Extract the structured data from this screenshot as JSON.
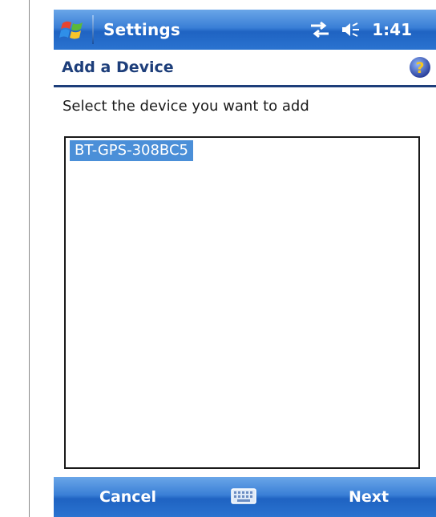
{
  "titlebar": {
    "app_title": "Settings",
    "time": "1:41",
    "icons": [
      "windows-start-icon",
      "connectivity-icon",
      "speaker-icon"
    ]
  },
  "header": {
    "page_title": "Add a Device",
    "help_icon": "help-icon"
  },
  "main": {
    "instruction": "Select the device you want to add",
    "devices": [
      {
        "name": "BT-GPS-308BC5",
        "selected": true
      }
    ]
  },
  "menubar": {
    "left_softkey": "Cancel",
    "right_softkey": "Next",
    "center_icon": "keyboard-icon"
  },
  "colors": {
    "bar_blue": "#2a73d0",
    "title_text": "#1d3e7a",
    "selection": "#4b8fd8"
  }
}
